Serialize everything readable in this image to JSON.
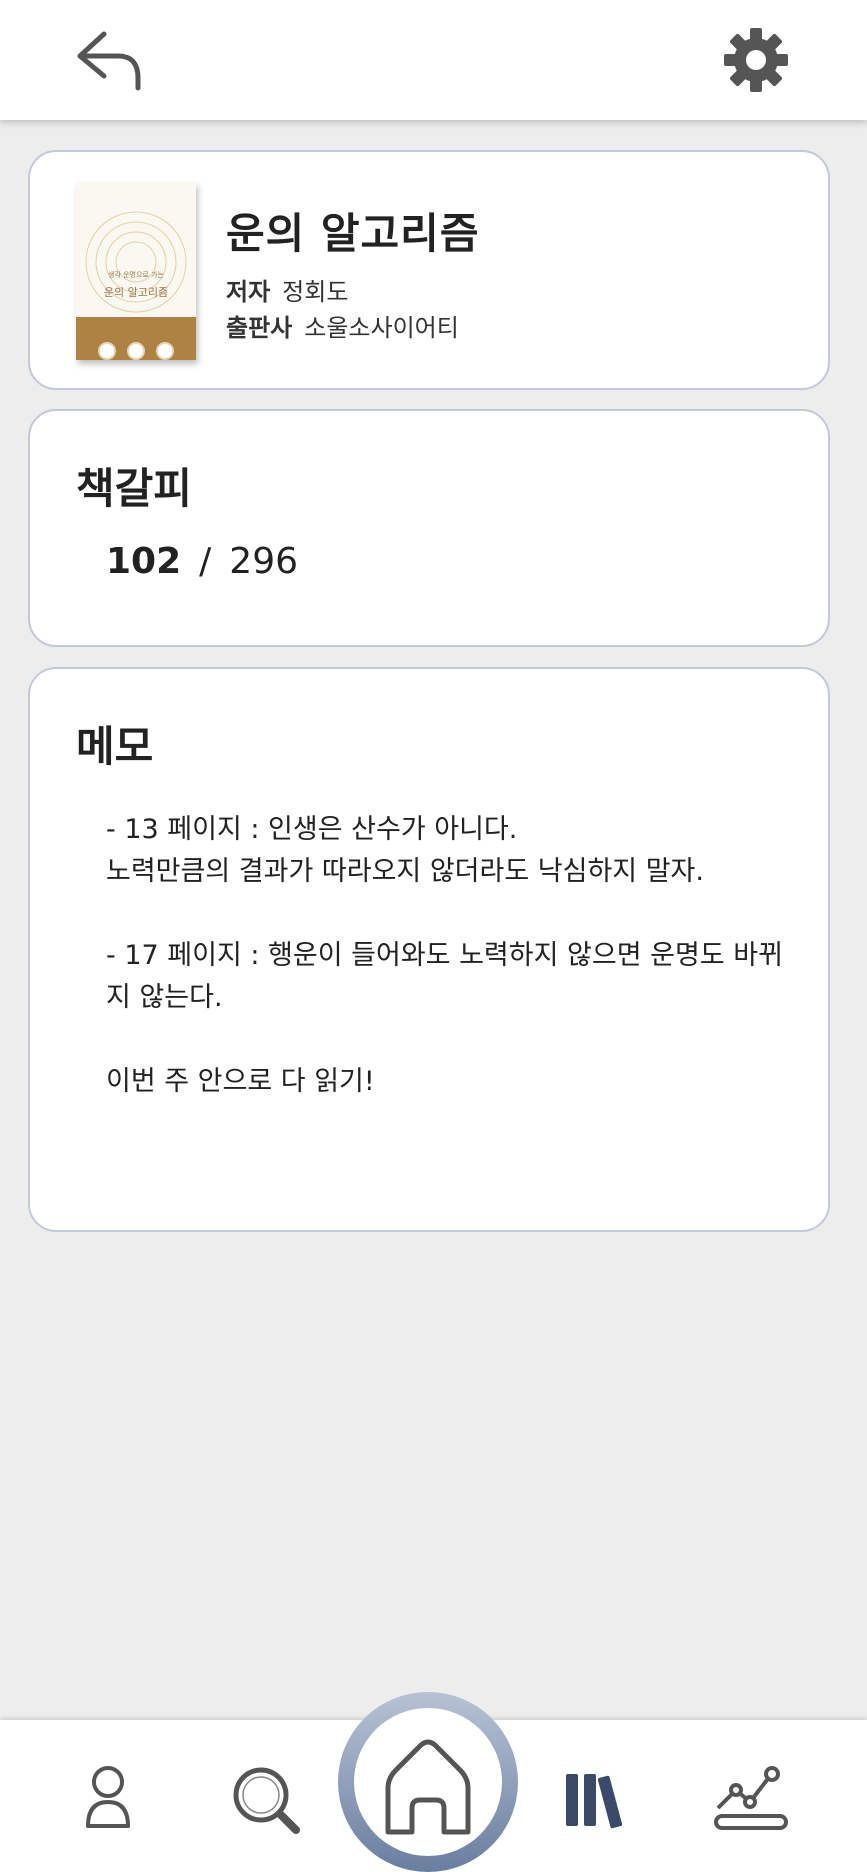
{
  "header": {
    "back_icon": "back-arrow-icon",
    "settings_icon": "gear-icon"
  },
  "book": {
    "cover_subtitle": "생각 운명으로 가는",
    "cover_title": "운의 알고리즘",
    "title": "운의 알고리즘",
    "author_label": "저자",
    "author": "정회도",
    "publisher_label": "출판사",
    "publisher": "소울소사이어티"
  },
  "bookmark": {
    "heading": "책갈피",
    "current_page": "102",
    "separator": "/",
    "total_pages": "296"
  },
  "memo": {
    "heading": "메모",
    "text": "- 13 페이지 : 인생은 산수가 아니다.\n노력만큼의 결과가 따라오지 않더라도 낙심하지 말자.\n\n- 17 페이지 : 행운이 들어와도 노력하지 않으면 운명도 바뀌지 않는다.\n\n이번 주 안으로 다 읽기!"
  },
  "nav": {
    "items": [
      "profile-icon",
      "search-icon",
      "home-icon",
      "library-icon",
      "stats-icon"
    ],
    "active_color": "#3b4a68",
    "icon_color": "#555555"
  }
}
